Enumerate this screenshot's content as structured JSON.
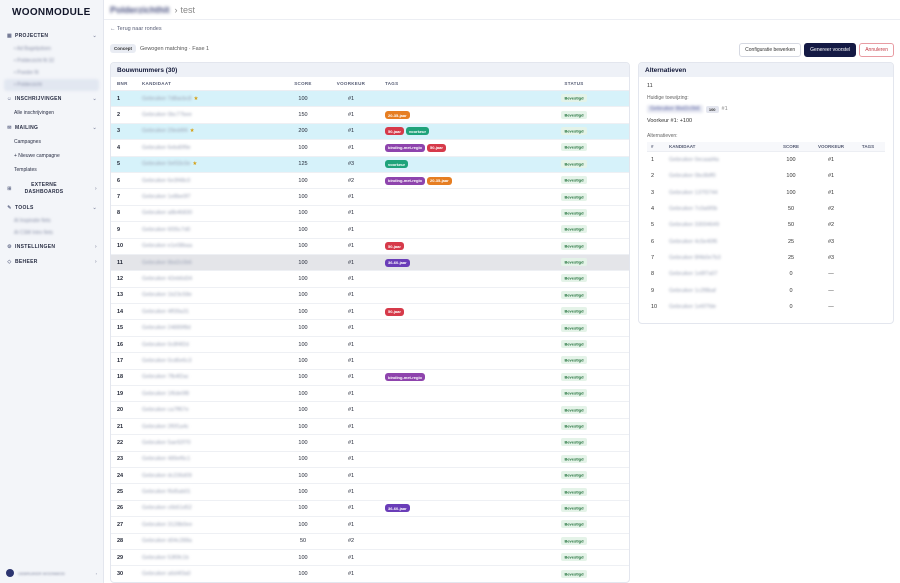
{
  "sidebar": {
    "logo": "WOONMODULE",
    "groups": [
      {
        "label": "PROJECTEN",
        "icon": "grid-icon"
      },
      {
        "label": "INSCHRIJVINGEN",
        "icon": "user-icon"
      },
      {
        "label": "MAILING",
        "icon": "mail-icon"
      },
      {
        "label": "EXTERNE DASHBOARDS",
        "icon": "dashboard-icon"
      },
      {
        "label": "TOOLS",
        "icon": "wrench-icon"
      },
      {
        "label": "INSTELLINGEN",
        "icon": "gear-icon"
      },
      {
        "label": "BEHEER",
        "icon": "shield-icon"
      }
    ],
    "projecten_items": [
      "• Ad Bagelpdoen",
      "• Polderzicht fit 32",
      "• Poeder fit",
      "• Polderzicht"
    ],
    "inschrijvingen_items": [
      "Alle inschrijvingen"
    ],
    "mailing_items": [
      "Campagnes",
      "+ Nieuwe campagne",
      "Templates"
    ],
    "tools_items": [
      "Al Inspiratie fiets",
      "Al CSM Intro fiets"
    ],
    "user": "GEBRUIKER WOONMOD"
  },
  "topbar": {
    "project": "Polderzichthit",
    "separator": "›",
    "title": "test"
  },
  "back_link": "← Terug naar rondes",
  "status": {
    "badge": "Concept",
    "text": "Gewogen matching · Fase 1"
  },
  "actions": {
    "configure": "Configuratie bewerken",
    "generate": "Genereer voorstel",
    "cancel": "Annuleren"
  },
  "left_panel": {
    "title": "Bouwnummers (30)",
    "columns": [
      "BNR",
      "KANDIDAAT",
      "SCORE",
      "VOORKEUR",
      "TAGS",
      "STATUS"
    ],
    "rows": [
      {
        "bnr": "1",
        "kandidaat": "Gebruiker 7d8acbc8",
        "star": true,
        "score": "100",
        "voorkeur": "#1",
        "tags": [],
        "status": "Bevestigd",
        "hl": "hl"
      },
      {
        "bnr": "2",
        "kandidaat": "Gebruiker 0bc77bee",
        "star": false,
        "score": "150",
        "voorkeur": "#1",
        "tags": [
          {
            "t": "20-35-jaar",
            "c": "#e67e22"
          }
        ],
        "status": "Bevestigd",
        "hl": ""
      },
      {
        "bnr": "3",
        "kandidaat": "Gebruiker 29ed4f4",
        "star": true,
        "score": "200",
        "voorkeur": "#1",
        "tags": [
          {
            "t": "50-jaar",
            "c": "#d63a4a"
          },
          {
            "t": "voorkeur",
            "c": "#1fa37a"
          }
        ],
        "status": "Bevestigd",
        "hl": "hl"
      },
      {
        "bnr": "4",
        "kandidaat": "Gebruiker 6ebd0f9e",
        "star": false,
        "score": "100",
        "voorkeur": "#1",
        "tags": [
          {
            "t": "binding-met-regio",
            "c": "#8e44ad"
          },
          {
            "t": "50-jaar",
            "c": "#d63a4a"
          }
        ],
        "status": "Bevestigd",
        "hl": ""
      },
      {
        "bnr": "5",
        "kandidaat": "Gebruiker 0ef33c0e",
        "star": true,
        "score": "125",
        "voorkeur": "#3",
        "tags": [
          {
            "t": "voorkeur",
            "c": "#1fa37a"
          }
        ],
        "status": "Bevestigd",
        "hl": "hl"
      },
      {
        "bnr": "6",
        "kandidaat": "Gebruiker 6e3f48c0",
        "star": false,
        "score": "100",
        "voorkeur": "#2",
        "tags": [
          {
            "t": "binding-met-regio",
            "c": "#8e44ad"
          },
          {
            "t": "20-35-jaar",
            "c": "#e67e22"
          }
        ],
        "status": "Bevestigd",
        "hl": ""
      },
      {
        "bnr": "7",
        "kandidaat": "Gebruiker 1e8be0f7",
        "star": false,
        "score": "100",
        "voorkeur": "#1",
        "tags": [],
        "status": "Bevestigd",
        "hl": ""
      },
      {
        "bnr": "8",
        "kandidaat": "Gebruiker a8b46830",
        "star": false,
        "score": "100",
        "voorkeur": "#1",
        "tags": [],
        "status": "Bevestigd",
        "hl": ""
      },
      {
        "bnr": "9",
        "kandidaat": "Gebruiker 6f35c7d0",
        "star": false,
        "score": "100",
        "voorkeur": "#1",
        "tags": [],
        "status": "Bevestigd",
        "hl": ""
      },
      {
        "bnr": "10",
        "kandidaat": "Gebruiker e1e08baa",
        "star": false,
        "score": "100",
        "voorkeur": "#1",
        "tags": [
          {
            "t": "50-jaar",
            "c": "#d63a4a"
          }
        ],
        "status": "Bevestigd",
        "hl": ""
      },
      {
        "bnr": "11",
        "kandidaat": "Gebruiker 8bd2c0b6",
        "star": false,
        "score": "100",
        "voorkeur": "#1",
        "tags": [
          {
            "t": "36-60-jaar",
            "c": "#6a3db8"
          }
        ],
        "status": "Bevestigd",
        "hl": "sel"
      },
      {
        "bnr": "12",
        "kandidaat": "Gebruiker 42eb6d34",
        "star": false,
        "score": "100",
        "voorkeur": "#1",
        "tags": [],
        "status": "Bevestigd",
        "hl": ""
      },
      {
        "bnr": "13",
        "kandidaat": "Gebruiker 1b23c58e",
        "star": false,
        "score": "100",
        "voorkeur": "#1",
        "tags": [],
        "status": "Bevestigd",
        "hl": ""
      },
      {
        "bnr": "14",
        "kandidaat": "Gebruiker 4ff39a31",
        "star": false,
        "score": "100",
        "voorkeur": "#1",
        "tags": [
          {
            "t": "50-jaar",
            "c": "#d63a4a"
          }
        ],
        "status": "Bevestigd",
        "hl": ""
      },
      {
        "bnr": "15",
        "kandidaat": "Gebruiker 24889f8d",
        "star": false,
        "score": "100",
        "voorkeur": "#1",
        "tags": [],
        "status": "Bevestigd",
        "hl": ""
      },
      {
        "bnr": "16",
        "kandidaat": "Gebruiker 0c8f4f2d",
        "star": false,
        "score": "100",
        "voorkeur": "#1",
        "tags": [],
        "status": "Bevestigd",
        "hl": ""
      },
      {
        "bnr": "17",
        "kandidaat": "Gebruiker 0cd6e6c3",
        "star": false,
        "score": "100",
        "voorkeur": "#1",
        "tags": [],
        "status": "Bevestigd",
        "hl": ""
      },
      {
        "bnr": "18",
        "kandidaat": "Gebruiker 7fb4f2ac",
        "star": false,
        "score": "100",
        "voorkeur": "#1",
        "tags": [
          {
            "t": "binding-met-regio",
            "c": "#8e44ad"
          }
        ],
        "status": "Bevestigd",
        "hl": ""
      },
      {
        "bnr": "19",
        "kandidaat": "Gebruiker 1f6de0f8",
        "star": false,
        "score": "100",
        "voorkeur": "#1",
        "tags": [],
        "status": "Bevestigd",
        "hl": ""
      },
      {
        "bnr": "20",
        "kandidaat": "Gebruiker ca7ff67e",
        "star": false,
        "score": "100",
        "voorkeur": "#1",
        "tags": [],
        "status": "Bevestigd",
        "hl": ""
      },
      {
        "bnr": "21",
        "kandidaat": "Gebruiker 2f0f1a4c",
        "star": false,
        "score": "100",
        "voorkeur": "#1",
        "tags": [],
        "status": "Bevestigd",
        "hl": ""
      },
      {
        "bnr": "22",
        "kandidaat": "Gebruiker 5ae92f70",
        "star": false,
        "score": "100",
        "voorkeur": "#1",
        "tags": [],
        "status": "Bevestigd",
        "hl": ""
      },
      {
        "bnr": "23",
        "kandidaat": "Gebruiker 489ef6c1",
        "star": false,
        "score": "100",
        "voorkeur": "#1",
        "tags": [],
        "status": "Bevestigd",
        "hl": ""
      },
      {
        "bnr": "24",
        "kandidaat": "Gebruiker dc236d09",
        "star": false,
        "score": "100",
        "voorkeur": "#1",
        "tags": [],
        "status": "Bevestigd",
        "hl": ""
      },
      {
        "bnr": "25",
        "kandidaat": "Gebruiker f6d5ab01",
        "star": false,
        "score": "100",
        "voorkeur": "#1",
        "tags": [],
        "status": "Bevestigd",
        "hl": ""
      },
      {
        "bnr": "26",
        "kandidaat": "Gebruiker c6b51d52",
        "star": false,
        "score": "100",
        "voorkeur": "#1",
        "tags": [
          {
            "t": "36-60-jaar",
            "c": "#6a3db8"
          }
        ],
        "status": "Bevestigd",
        "hl": ""
      },
      {
        "bnr": "27",
        "kandidaat": "Gebruiker 3128b0ee",
        "star": false,
        "score": "100",
        "voorkeur": "#1",
        "tags": [],
        "status": "Bevestigd",
        "hl": ""
      },
      {
        "bnr": "28",
        "kandidaat": "Gebruiker d04c288a",
        "star": false,
        "score": "50",
        "voorkeur": "#2",
        "tags": [],
        "status": "Bevestigd",
        "hl": ""
      },
      {
        "bnr": "29",
        "kandidaat": "Gebruiker 53f0fc1b",
        "star": false,
        "score": "100",
        "voorkeur": "#1",
        "tags": [],
        "status": "Bevestigd",
        "hl": ""
      },
      {
        "bnr": "30",
        "kandidaat": "Gebruiker a6d4f3a0",
        "star": false,
        "score": "100",
        "voorkeur": "#1",
        "tags": [],
        "status": "Bevestigd",
        "hl": ""
      }
    ]
  },
  "right_panel": {
    "title": "Alternatieven",
    "number": "11",
    "current_label": "Huidige toewijzing:",
    "current_name": "Gebruiker 8bd2c0b6",
    "current_score": "100",
    "current_pref": "#1",
    "voorkeur_line": "Voorkeur #1: +100",
    "alt_label": "Alternatieven:",
    "columns": [
      "#",
      "KANDIDAAT",
      "SCORE",
      "VOORKEUR",
      "TAGS"
    ],
    "rows": [
      {
        "n": "1",
        "k": "Gebruiker 0ecaad4a",
        "s": "100",
        "v": "#1"
      },
      {
        "n": "2",
        "k": "Gebruiker 0bc8bff0",
        "s": "100",
        "v": "#1"
      },
      {
        "n": "3",
        "k": "Gebruiker 137f3744",
        "s": "100",
        "v": "#1"
      },
      {
        "n": "4",
        "k": "Gebruiker 7c0a6f0b",
        "s": "50",
        "v": "#2"
      },
      {
        "n": "5",
        "k": "Gebruiker 33004649",
        "s": "50",
        "v": "#2"
      },
      {
        "n": "6",
        "k": "Gebruiker 4c5e40f6",
        "s": "25",
        "v": "#3"
      },
      {
        "n": "7",
        "k": "Gebruiker 8f4b0e7b3",
        "s": "25",
        "v": "#3"
      },
      {
        "n": "8",
        "k": "Gebruiker 1e8f7a07",
        "s": "0",
        "v": "—"
      },
      {
        "n": "9",
        "k": "Gebruiker 1c2f8baf",
        "s": "0",
        "v": "—"
      },
      {
        "n": "10",
        "k": "Gebruiker 1e6f7fde",
        "s": "0",
        "v": "—"
      }
    ]
  }
}
